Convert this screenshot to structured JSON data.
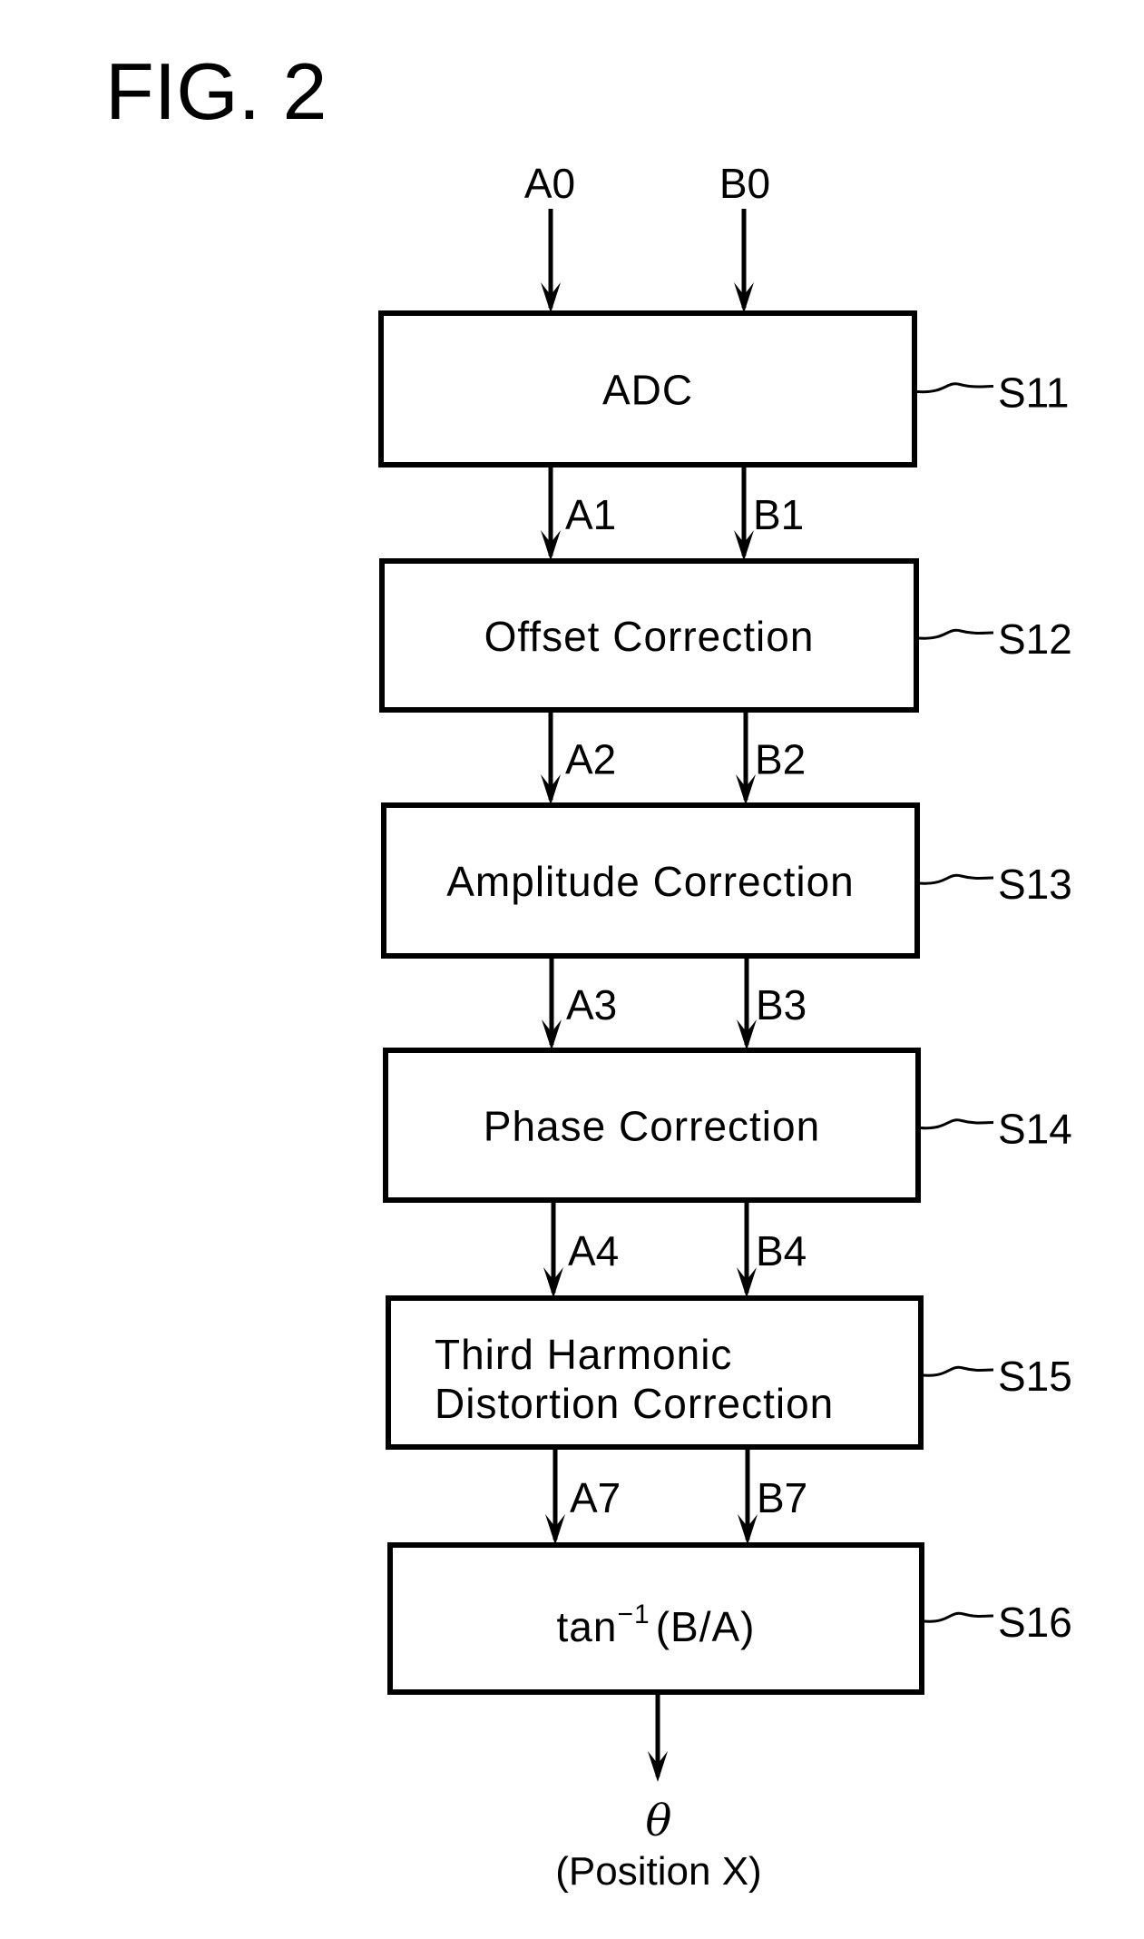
{
  "figure": {
    "title": "FIG. 2",
    "inputs": {
      "a": "A0",
      "b": "B0"
    },
    "steps": [
      {
        "id": "S11",
        "lines": [
          "ADC"
        ],
        "out_a": "A1",
        "out_b": "B1"
      },
      {
        "id": "S12",
        "lines": [
          "Offset Correction"
        ],
        "out_a": "A2",
        "out_b": "B2"
      },
      {
        "id": "S13",
        "lines": [
          "Amplitude Correction"
        ],
        "out_a": "A3",
        "out_b": "B3"
      },
      {
        "id": "S14",
        "lines": [
          "Phase Correction"
        ],
        "out_a": "A4",
        "out_b": "B4"
      },
      {
        "id": "S15",
        "lines": [
          "Third Harmonic",
          "Distortion Correction"
        ],
        "out_a": "A7",
        "out_b": "B7"
      },
      {
        "id": "S16",
        "formula": {
          "func": "tan",
          "exp": "−1",
          "arg": "(B/A)"
        }
      }
    ],
    "output": {
      "symbol": "θ",
      "label": "(Position X)"
    }
  }
}
